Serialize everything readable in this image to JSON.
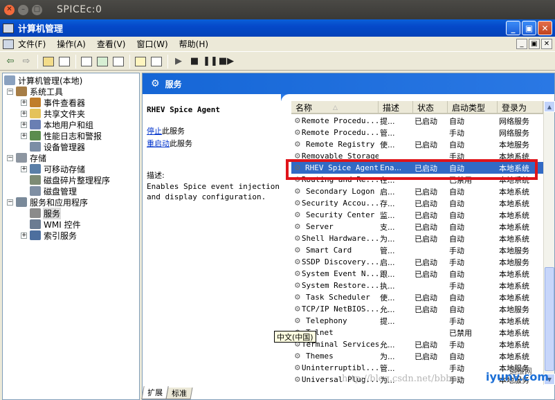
{
  "vm": {
    "title": "SPICEc:0",
    "close_glyph": "✕",
    "min_glyph": "–",
    "max_glyph": "□"
  },
  "window": {
    "title": "计算机管理",
    "buttons": [
      "_",
      "▣",
      "✕"
    ]
  },
  "menu": {
    "items": [
      "文件(F)",
      "操作(A)",
      "查看(V)",
      "窗口(W)",
      "帮助(H)"
    ],
    "mdi_buttons": [
      "_",
      "▣",
      "✕"
    ]
  },
  "tree": {
    "items": [
      {
        "label": "计算机管理(本地)",
        "pm": "",
        "color": "#8aa1bf"
      },
      {
        "label": "系统工具",
        "pm": "−",
        "color": "#a67d46"
      },
      {
        "label": "事件查看器",
        "pm": "+",
        "color": "#c07d2a"
      },
      {
        "label": "共享文件夹",
        "pm": "+",
        "color": "#e4c25a"
      },
      {
        "label": "本地用户和组",
        "pm": "+",
        "color": "#6a7fb3"
      },
      {
        "label": "性能日志和警报",
        "pm": "+",
        "color": "#5b8c4e"
      },
      {
        "label": "设备管理器",
        "pm": "",
        "color": "#7c8ea6"
      },
      {
        "label": "存储",
        "pm": "−",
        "color": "#8d96a1"
      },
      {
        "label": "可移动存储",
        "pm": "+",
        "color": "#5a7fa8"
      },
      {
        "label": "磁盘碎片整理程序",
        "pm": "",
        "color": "#7d8b74"
      },
      {
        "label": "磁盘管理",
        "pm": "",
        "color": "#7f8fa3"
      },
      {
        "label": "服务和应用程序",
        "pm": "−",
        "color": "#7a8a9a"
      },
      {
        "label": "服务",
        "pm": "",
        "color": "#8b8b8b"
      },
      {
        "label": "WMI 控件",
        "pm": "",
        "color": "#6b7c92"
      },
      {
        "label": "索引服务",
        "pm": "+",
        "color": "#4d6f9e"
      }
    ]
  },
  "panel": {
    "header": "服务"
  },
  "desc": {
    "title": "RHEV Spice Agent",
    "stop_link": "停止",
    "stop_suffix": "此服务",
    "restart_link": "重启动",
    "restart_suffix": "此服务",
    "label": "描述:",
    "line1": "Enables Spice event injection",
    "line2": "and display configuration."
  },
  "list": {
    "columns": [
      "名称",
      "描述",
      "状态",
      "启动类型",
      "登录为"
    ],
    "sort_glyph": "△",
    "rows": [
      {
        "name": "Remote Procedu...",
        "desc": "提...",
        "status": "已启动",
        "startup": "自动",
        "logon": "网络服务"
      },
      {
        "name": "Remote Procedu...",
        "desc": "管...",
        "status": "",
        "startup": "手动",
        "logon": "网络服务"
      },
      {
        "name": "Remote Registry",
        "desc": "使...",
        "status": "已启动",
        "startup": "自动",
        "logon": "本地服务"
      },
      {
        "name": "Removable Storage",
        "desc": "",
        "status": "",
        "startup": "手动",
        "logon": "本地系统"
      },
      {
        "name": "RHEV Spice Agent",
        "desc": "Ena...",
        "status": "已启动",
        "startup": "自动",
        "logon": "本地系统"
      },
      {
        "name": "Routing and Re...",
        "desc": "在...",
        "status": "",
        "startup": "已禁用",
        "logon": "本地系统"
      },
      {
        "name": "Secondary Logon",
        "desc": "启...",
        "status": "已启动",
        "startup": "自动",
        "logon": "本地系统"
      },
      {
        "name": "Security Accou...",
        "desc": "存...",
        "status": "已启动",
        "startup": "自动",
        "logon": "本地系统"
      },
      {
        "name": "Security Center",
        "desc": "监...",
        "status": "已启动",
        "startup": "自动",
        "logon": "本地系统"
      },
      {
        "name": "Server",
        "desc": "支...",
        "status": "已启动",
        "startup": "自动",
        "logon": "本地系统"
      },
      {
        "name": "Shell Hardware...",
        "desc": "为...",
        "status": "已启动",
        "startup": "自动",
        "logon": "本地系统"
      },
      {
        "name": "Smart Card",
        "desc": "管...",
        "status": "",
        "startup": "手动",
        "logon": "本地服务"
      },
      {
        "name": "SSDP Discovery...",
        "desc": "启...",
        "status": "已启动",
        "startup": "手动",
        "logon": "本地服务"
      },
      {
        "name": "System Event N...",
        "desc": "跟...",
        "status": "已启动",
        "startup": "自动",
        "logon": "本地系统"
      },
      {
        "name": "System Restore...",
        "desc": "执...",
        "status": "",
        "startup": "手动",
        "logon": "本地系统"
      },
      {
        "name": "Task Scheduler",
        "desc": "使...",
        "status": "已启动",
        "startup": "自动",
        "logon": "本地系统"
      },
      {
        "name": "TCP/IP NetBIOS...",
        "desc": "允...",
        "status": "已启动",
        "startup": "自动",
        "logon": "本地服务"
      },
      {
        "name": "Telephony",
        "desc": "提...",
        "status": "",
        "startup": "手动",
        "logon": "本地系统"
      },
      {
        "name": "Telnet",
        "desc": "",
        "status": "",
        "startup": "已禁用",
        "logon": "本地系统"
      },
      {
        "name": "Terminal Services",
        "desc": "允...",
        "status": "已启动",
        "startup": "手动",
        "logon": "本地系统"
      },
      {
        "name": "Themes",
        "desc": "为...",
        "status": "已启动",
        "startup": "自动",
        "logon": "本地系统"
      },
      {
        "name": "Uninterruptibl...",
        "desc": "管...",
        "status": "",
        "startup": "手动",
        "logon": "本地服务"
      },
      {
        "name": "Universal Plug...",
        "desc": "为...",
        "status": "",
        "startup": "手动",
        "logon": "本地服务"
      }
    ],
    "selected_index": 4
  },
  "tooltip": "中文(中国)",
  "tabs": [
    "扩展",
    "标准"
  ],
  "watermark": "http://blog.csdn.net/bbboy",
  "watermark_logo": "iyunv.com",
  "watermark_logo_sub": "运维网"
}
